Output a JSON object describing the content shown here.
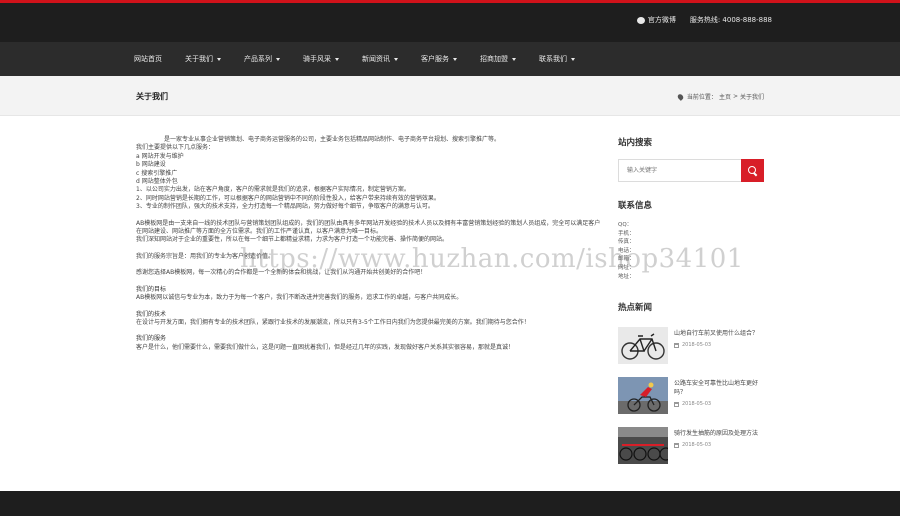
{
  "topbar": {
    "weibo": "官方微博",
    "hotline": "服务热线: 4008-888-888"
  },
  "nav": [
    {
      "label": "网站首页",
      "caret": false
    },
    {
      "label": "关于我们",
      "caret": true
    },
    {
      "label": "产品系列",
      "caret": true
    },
    {
      "label": "骑手风采",
      "caret": true
    },
    {
      "label": "新闻资讯",
      "caret": true
    },
    {
      "label": "客户服务",
      "caret": true
    },
    {
      "label": "招商加盟",
      "caret": true
    },
    {
      "label": "联系我们",
      "caret": true
    }
  ],
  "titlebar": {
    "title": "关于我们",
    "crumb_prefix": "当前位置：",
    "crumb_home": "主页",
    "crumb_sep": ">",
    "crumb_current": "关于我们"
  },
  "content": {
    "intro": "是一家专业从事企业营销策划、电子商务运营服务的公司，主要业务包括精品网站制作、电子商务平台规划、搜索引擎推广等。",
    "services_heading": "我们主要提供以下几点服务：",
    "services": [
      "a 网站开发与维护",
      "b 网站建设",
      "c 搜索引擎推广",
      "d 网站整体外包"
    ],
    "points": [
      "1、以公司实力出发，站在客户角度，客户的需求就是我们的追求，根据客户实际情况，制定营销方案。",
      "2、同时网站营销是长期的工作，可以根据客户的网站营销中不同的阶段性投入，给客户带来持续有效的营销效果。",
      "3、专业的制作团队，强大的技术支持，全力打造每一个精品网站，努力做好每个细节，争取客户的满意与认可。"
    ],
    "para_team": "AB模板网是由一支来自一线的技术团队与营销策划团队组成的，我们的团队由具有多年网站开发经验的技术人员以及拥有丰富营销策划经验的策划人员组成，完全可以满足客户在网站建设、网站推广等方面的全方位需求。我们的工作严谨认真，以客户满意为唯一目标。",
    "para_team_2": "我们深知网站对于企业的重要性，所以在每一个细节上都精益求精，力求为客户打造一个功能完善、操作简便的网站。",
    "para_service": "我们的服务宗旨是：用我们的专业为客户创造价值。",
    "para_choose": "感谢您选择AB模板网，每一次精心的合作都是一个全新的体会和挑战，让我们从沟通开始共创美好的合作吧！",
    "h_goal": "我们的目标",
    "goal": "AB模板网以诚信与专业为本，致力于为每一个客户，我们不断改进并完善我们的服务，追求工作的卓越，与客户共同成长。",
    "h_tech": "我们的技术",
    "tech": "在设计与开发方面，我们拥有专业的技术团队，紧跟行业技术的发展潮流，所以只有3-5个工作日内我们为您提供最完美的方案。我们期待与您合作！",
    "h_care": "我们的服务",
    "care": "客户是什么，他们需要什么，需要我们做什么，这是问题一直困扰着我们，但是经过几年的实践，发现做好客户关系其实很容易，那就是真诚！"
  },
  "sidebar": {
    "search_title": "站内搜索",
    "search_placeholder": "输入关键字",
    "contact_title": "联系信息",
    "contact": [
      "QQ：",
      "手机：",
      "传真：",
      "电话：",
      "邮箱：",
      "网址：",
      "地址："
    ],
    "hot_title": "热点新闻",
    "news": [
      {
        "title": "山地自行车前叉使用什么组合？",
        "date": "2018-05-03"
      },
      {
        "title": "公路车安全可靠性比山地车更好吗？",
        "date": "2018-05-03"
      },
      {
        "title": "骑行发生抽筋的原因及处理方法",
        "date": "2018-05-03"
      }
    ]
  },
  "watermark": "https://www.huzhan.com/ishop34101",
  "colors": {
    "accent": "#d81e28",
    "topbar": "#1e1e1e",
    "navbar": "#2c2c2c",
    "titlebar": "#f3f3f3"
  }
}
